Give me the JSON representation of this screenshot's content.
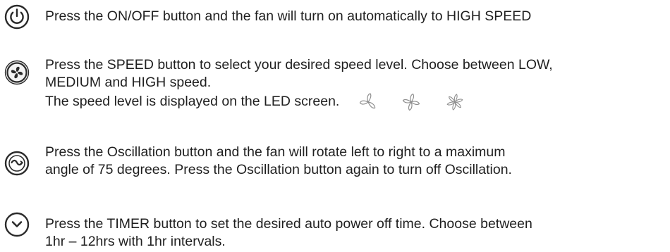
{
  "items": [
    {
      "icon": "power-icon",
      "lines": [
        "Press the ON/OFF button and the fan will turn on automatically to HIGH SPEED"
      ]
    },
    {
      "icon": "fan-speed-icon",
      "lines": [
        "Press the SPEED button to select your desired speed level. Choose between LOW,",
        "MEDIUM and HIGH speed.",
        "The speed level is displayed on the LED screen."
      ],
      "speed_indicators": [
        "fan-low-icon",
        "fan-medium-icon",
        "fan-high-icon"
      ]
    },
    {
      "icon": "oscillation-icon",
      "lines": [
        "Press the Oscillation button and the fan will rotate left to right to a maximum",
        "angle of 75 degrees. Press the Oscillation button again to turn off Oscillation."
      ]
    },
    {
      "icon": "timer-icon",
      "lines": [
        "Press the TIMER button to set the desired auto power off time. Choose between",
        "1hr – 12hrs with 1hr intervals."
      ]
    }
  ],
  "colors": {
    "text": "#1f1f1f",
    "icon": "#2a2a2a",
    "fan_indicator": "#9a9a9a"
  }
}
